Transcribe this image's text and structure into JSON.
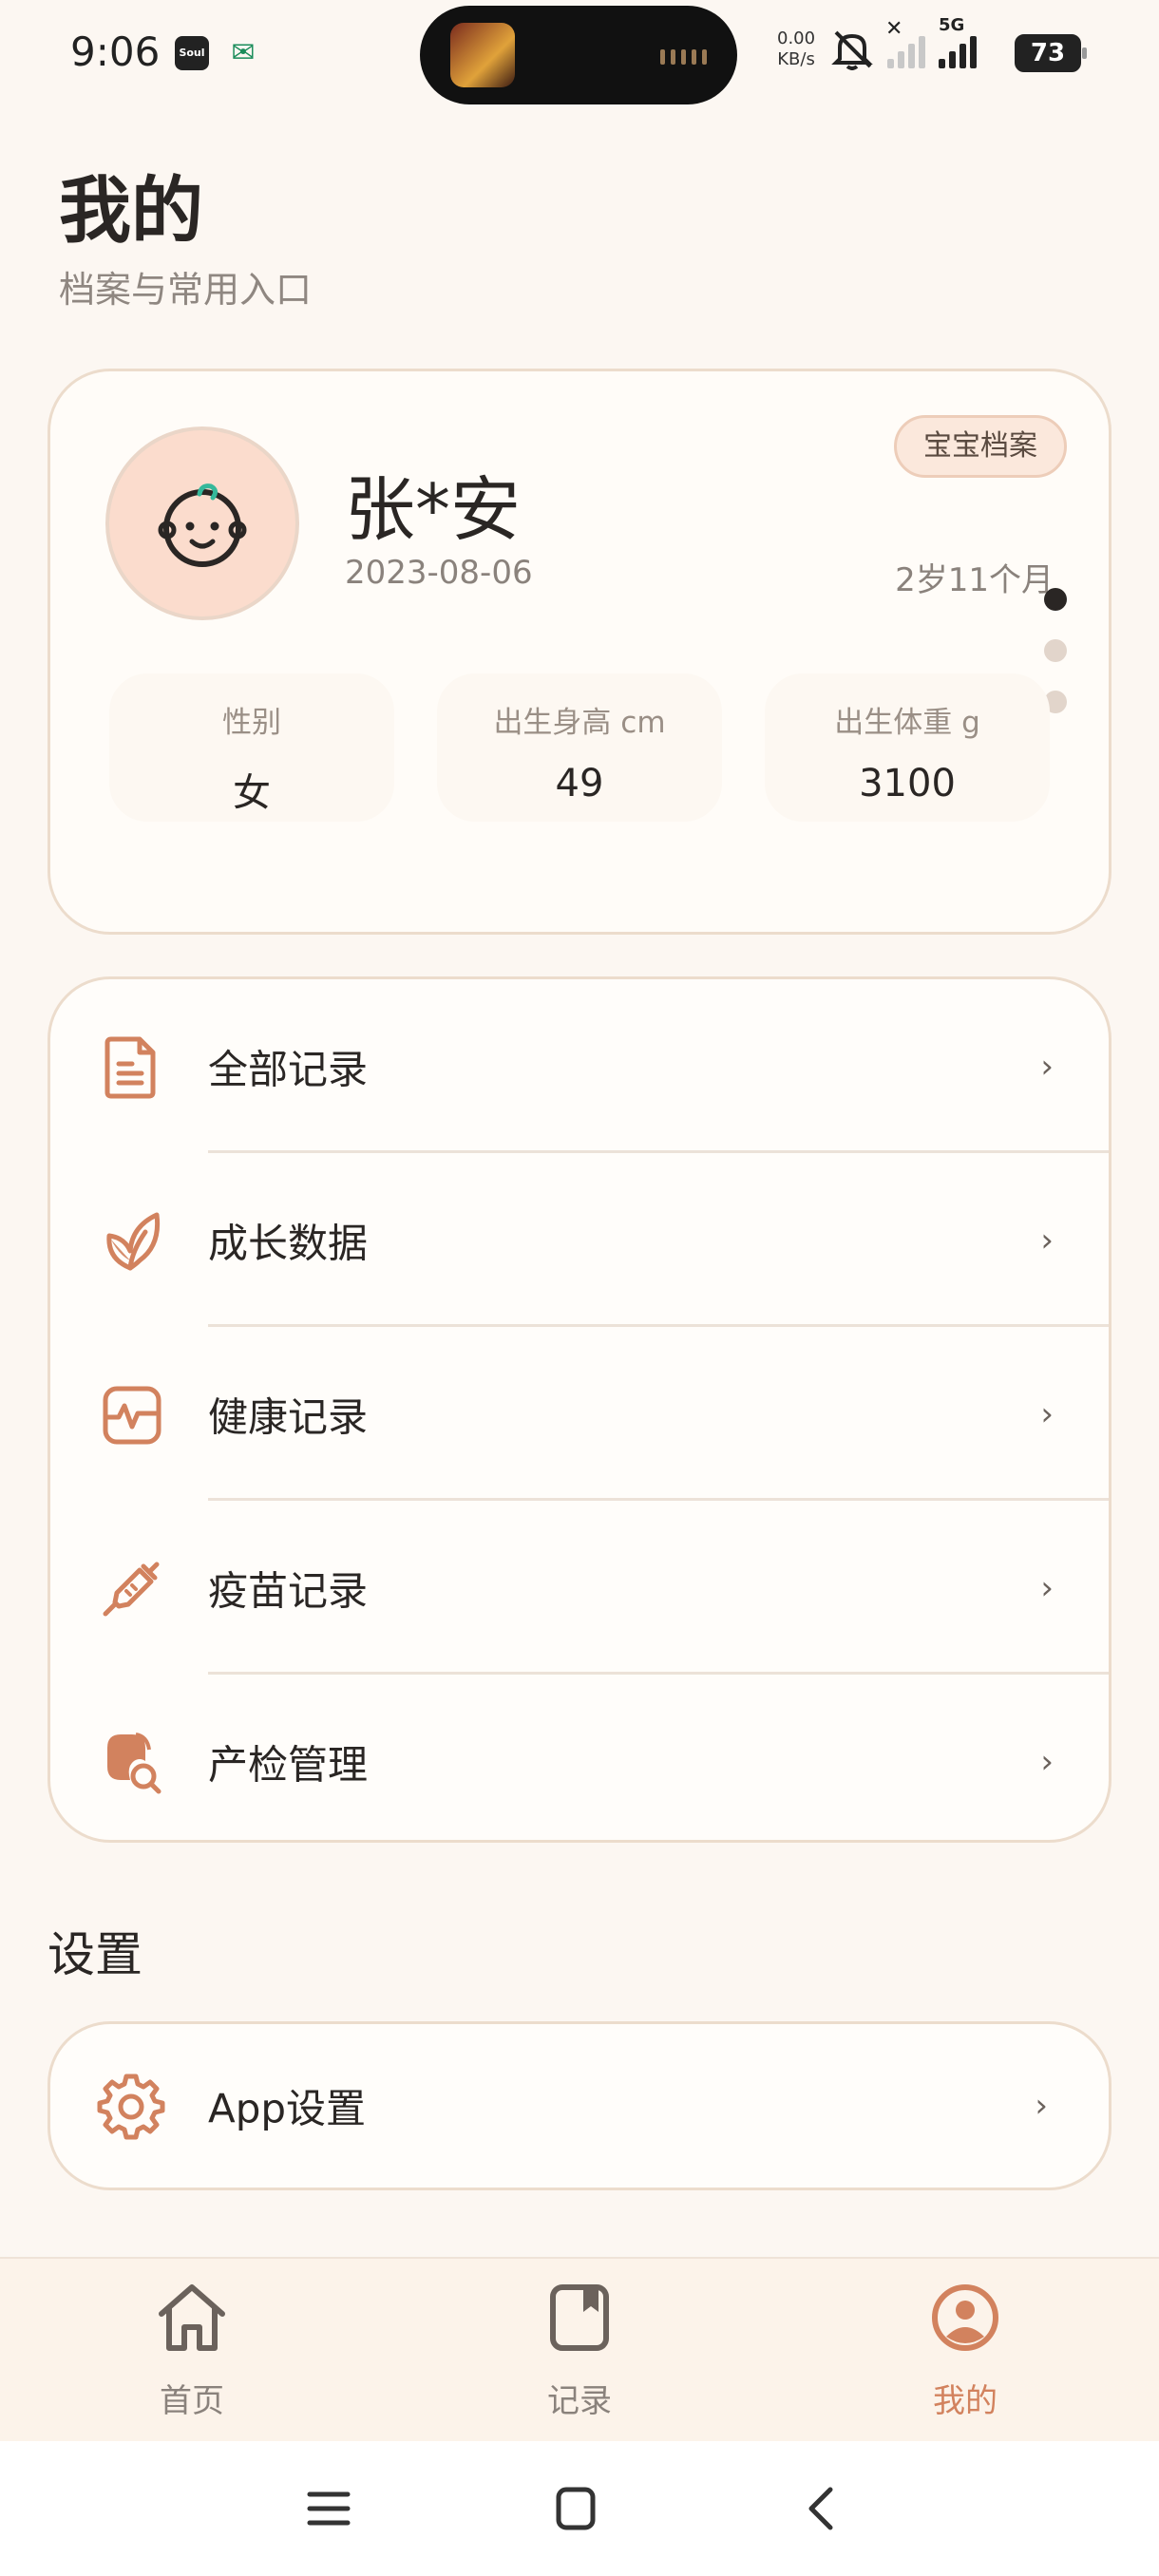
{
  "status_bar": {
    "time": "9:06",
    "app_soul": "Soul",
    "net_speed_value": "0.00",
    "net_speed_unit": "KB/s",
    "network_type": "5G",
    "battery": "73"
  },
  "header": {
    "title": "我的",
    "subtitle": "档案与常用入口"
  },
  "profile": {
    "name": "张*安",
    "birth_date": "2023-08-06",
    "badge": "宝宝档案",
    "age": "2岁11个月",
    "carousel_page": 1,
    "carousel_pages": 3,
    "stats": [
      {
        "label": "性别",
        "value": "女"
      },
      {
        "label": "出生身高 cm",
        "value": "49"
      },
      {
        "label": "出生体重 g",
        "value": "3100"
      }
    ]
  },
  "menu": {
    "items": [
      {
        "label": "全部记录",
        "icon": "document-icon"
      },
      {
        "label": "成长数据",
        "icon": "leaf-icon"
      },
      {
        "label": "健康记录",
        "icon": "pulse-icon"
      },
      {
        "label": "疫苗记录",
        "icon": "syringe-icon"
      },
      {
        "label": "产检管理",
        "icon": "prenatal-search-icon"
      }
    ],
    "chevron": "›"
  },
  "settings": {
    "section_title": "设置",
    "app_settings_label": "App设置",
    "icon": "gear-icon"
  },
  "bottom_nav": {
    "items": [
      {
        "label": "首页",
        "icon": "home-icon",
        "active": false
      },
      {
        "label": "记录",
        "icon": "record-book-icon",
        "active": false
      },
      {
        "label": "我的",
        "icon": "profile-icon",
        "active": true
      }
    ]
  },
  "colors": {
    "background": "#fcf7f2",
    "accent": "#d2825e",
    "card_border": "#ecdccc",
    "avatar_bg": "#fbdccd"
  }
}
